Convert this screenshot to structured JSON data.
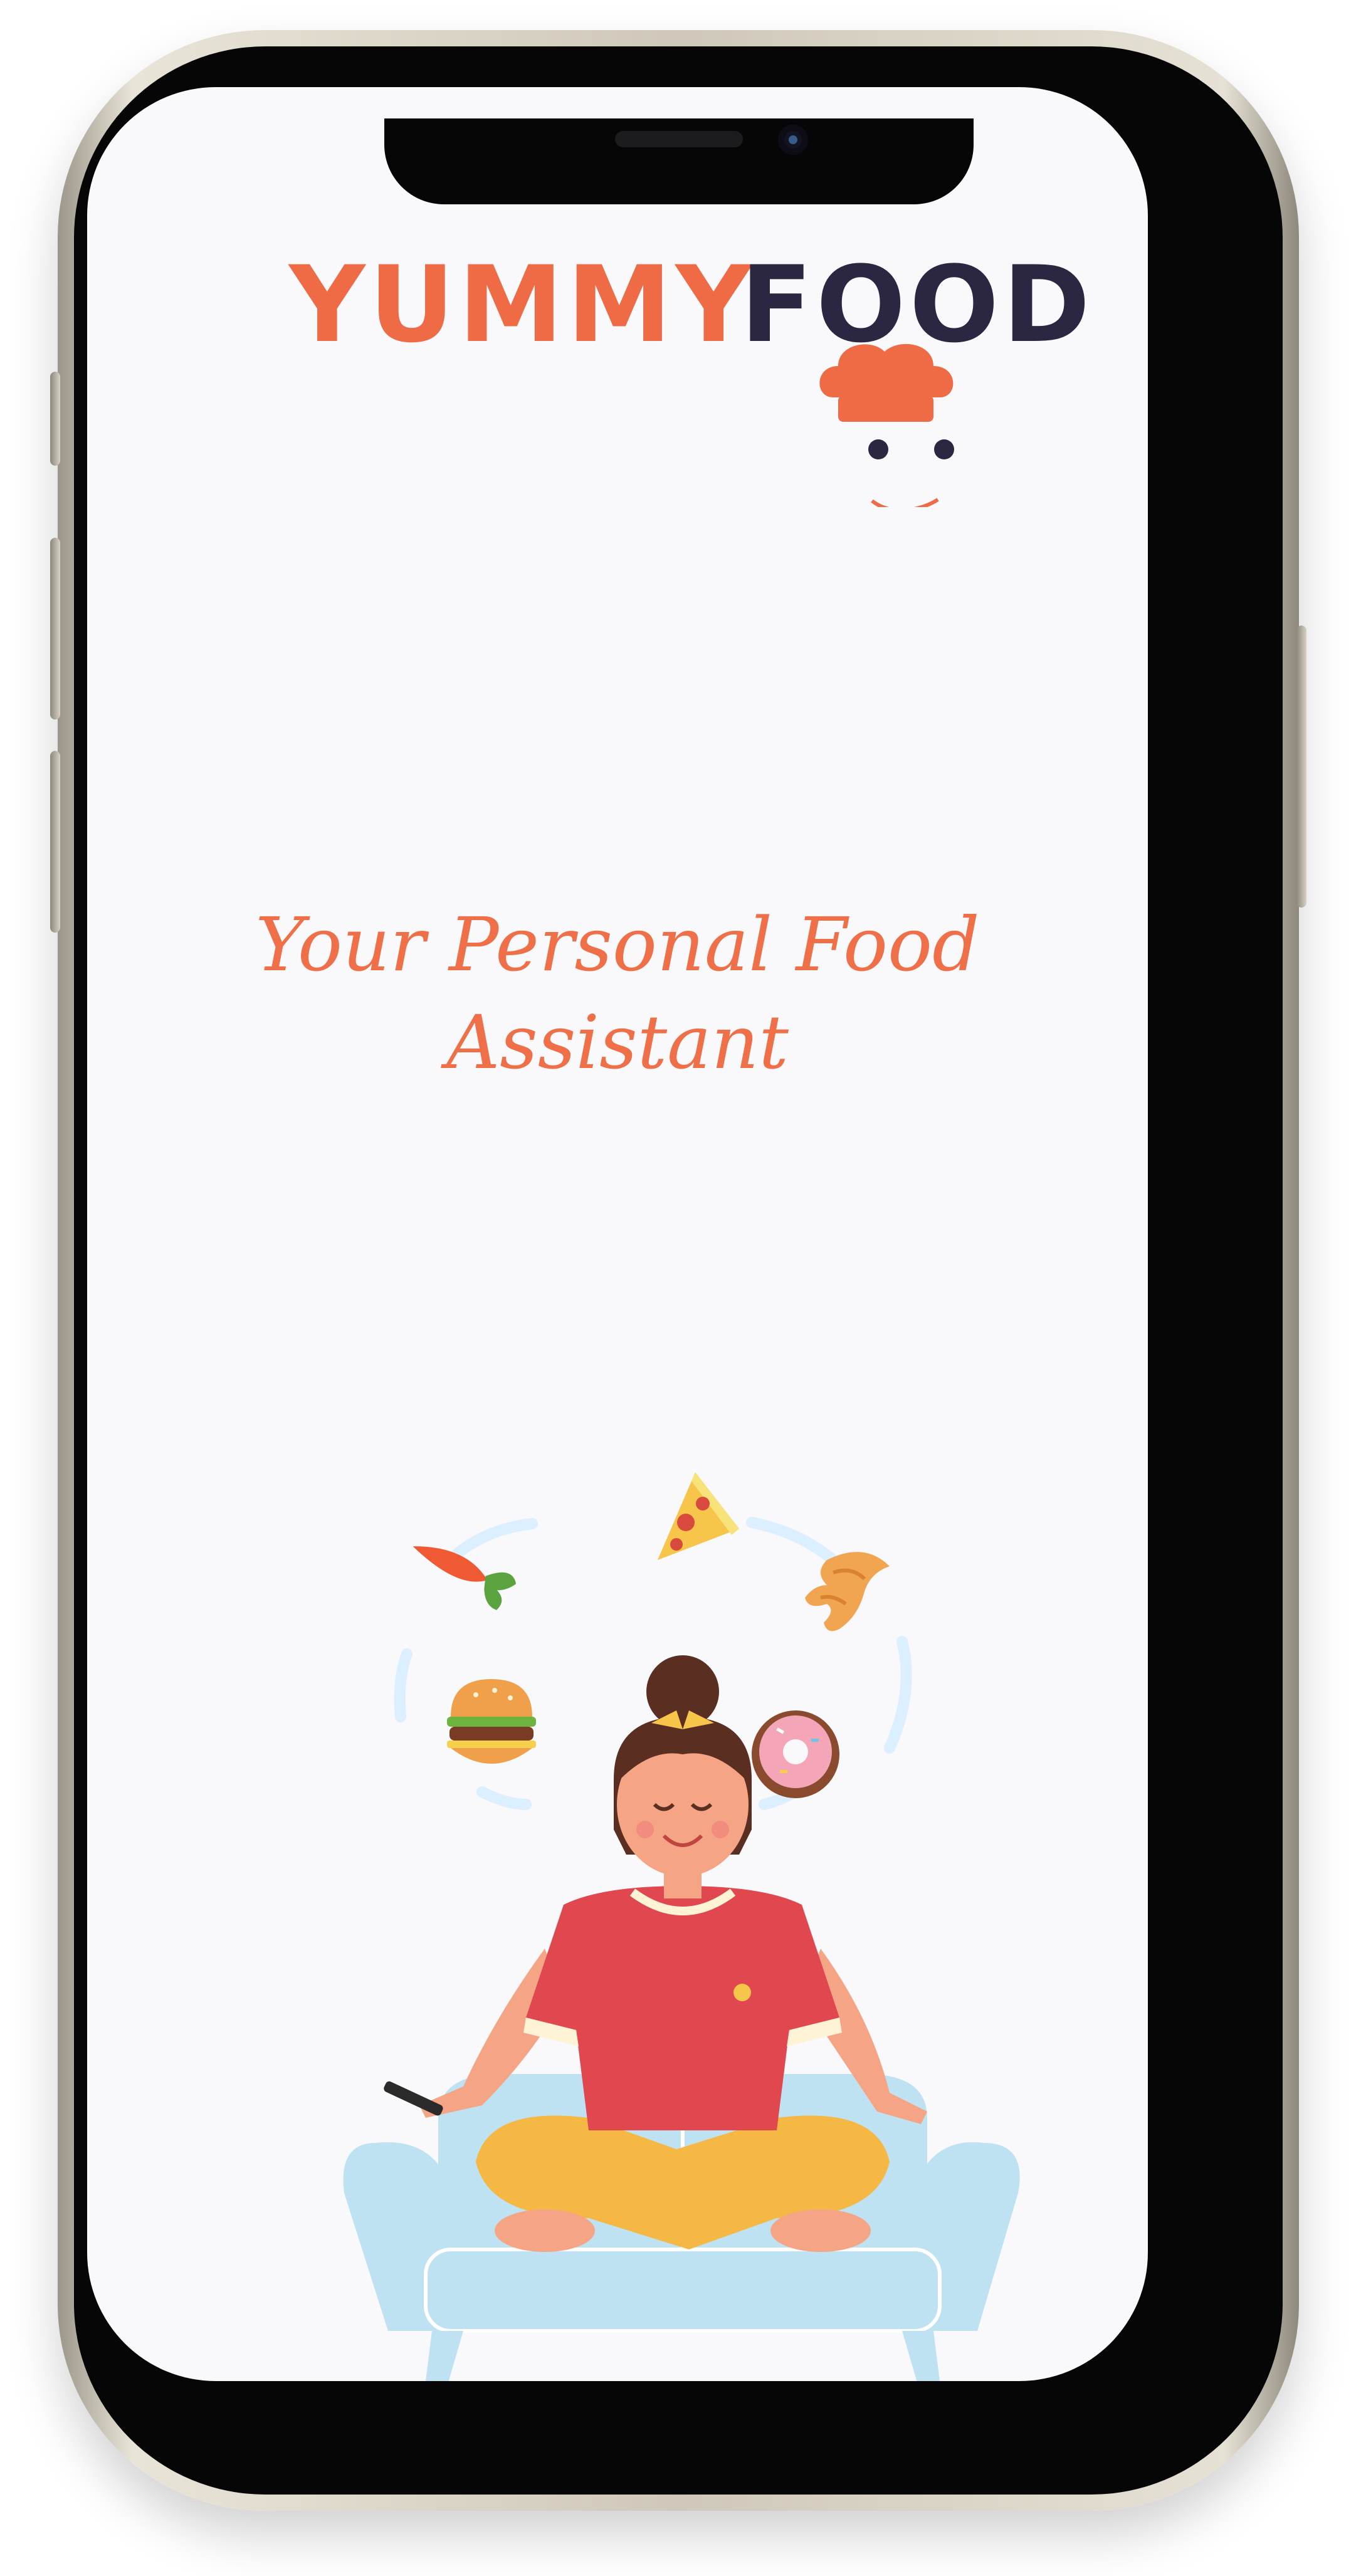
{
  "logo": {
    "word1": "YUMMY",
    "word2": "FOOD",
    "colors": {
      "primary": "#ef6b45",
      "secondary": "#2b2742"
    }
  },
  "tagline": {
    "line1": "Your Personal Food",
    "line2": "Assistant"
  },
  "illustration": {
    "name": "woman-meditating-with-food",
    "items": [
      "pizza-slice-icon",
      "carrot-icon",
      "croissant-icon",
      "burger-icon",
      "donut-icon",
      "smartphone-icon",
      "sofa-icon"
    ]
  },
  "theme": {
    "screen_background": "#f9f9fb",
    "accent": "#ef7048",
    "sofa": "#bfe2f2",
    "shirt": "#e0474f",
    "pants": "#f6b844"
  }
}
